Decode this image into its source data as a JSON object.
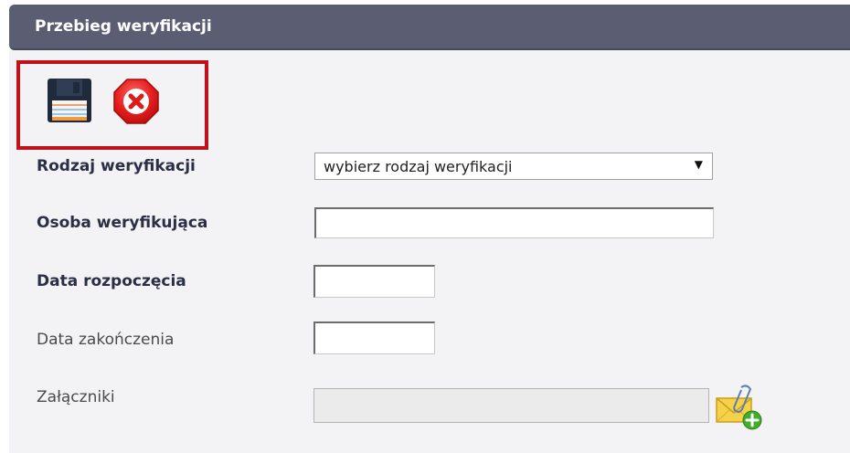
{
  "header": {
    "title": "Przebieg weryfikacji"
  },
  "toolbar": {
    "save_icon": "floppy-disk-save-icon",
    "cancel_icon": "red-octagon-x-cancel-icon"
  },
  "form": {
    "verification_type": {
      "label": "Rodzaj weryfikacji",
      "selected": "wybierz rodzaj weryfikacji"
    },
    "verifier": {
      "label": "Osoba weryfikująca",
      "value": ""
    },
    "start_date": {
      "label": "Data rozpoczęcia",
      "value": ""
    },
    "end_date": {
      "label": "Data zakończenia",
      "value": ""
    },
    "attachments": {
      "label": "Załączniki",
      "value": "",
      "add_icon": "envelope-paperclip-add-icon"
    }
  },
  "colors": {
    "header_bg": "#5b5e73",
    "highlight_border": "#c1121c",
    "panel_bg": "#f3f3f5",
    "label_text": "#2b2f45"
  }
}
